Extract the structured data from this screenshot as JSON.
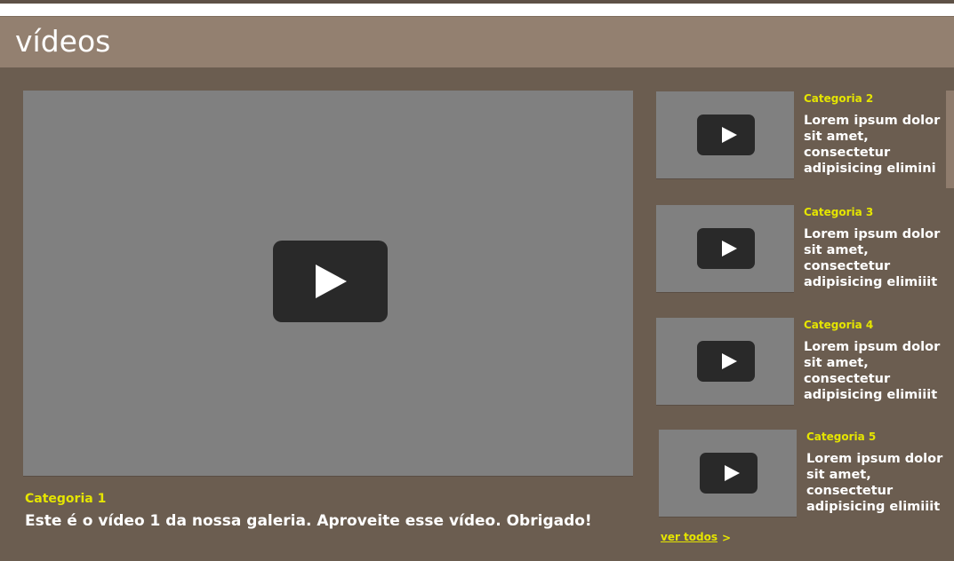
{
  "header": {
    "title": "vídeos"
  },
  "main_video": {
    "category": "Categoria 1",
    "title": "Este é o vídeo 1 da nossa galeria. Aproveite esse vídeo. Obrigado!",
    "icon": "play-icon"
  },
  "side_videos": [
    {
      "category": "Categoria 2",
      "description": "Lorem ipsum dolor sit amet, consectetur adipisicing elimini",
      "icon": "play-icon"
    },
    {
      "category": "Categoria 3",
      "description": "Lorem ipsum dolor sit amet, consectetur adipisicing elimiiit",
      "icon": "play-icon"
    },
    {
      "category": "Categoria 4",
      "description": "Lorem ipsum dolor sit amet, consectetur adipisicing elimiiit",
      "icon": "play-icon"
    },
    {
      "category": "Categoria 5",
      "description": "Lorem ipsum dolor sit amet, consectetur adipisicing elimiiit",
      "icon": "play-icon"
    }
  ],
  "footer": {
    "see_all_label": "ver todos",
    "see_all_arrow": ">"
  },
  "colors": {
    "background": "#6b5d50",
    "header": "#938070",
    "accent": "#e5e500",
    "video_placeholder": "#808080",
    "play_button": "#292929"
  }
}
